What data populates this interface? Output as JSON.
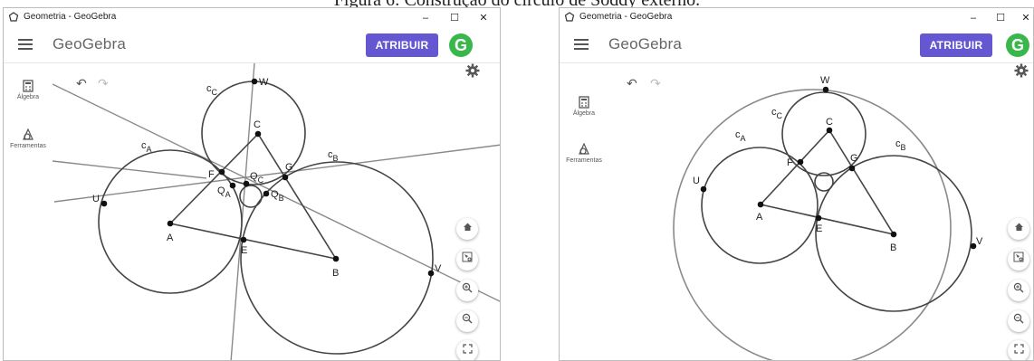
{
  "caption": "Figura 6: Construção do círculo de Soddy externo.",
  "windows": [
    {
      "title": "Geometria - GeoGebra",
      "controls": {
        "minimize": "–",
        "maximize": "☐",
        "close": "✕"
      },
      "brand": "GeoGebra",
      "assign_label": "ATRIBUIR",
      "avatar_letter": "G",
      "sidebar": {
        "algebra": "Álgebra",
        "tools": "Ferramentas"
      },
      "labels": {
        "W": "W",
        "C": "C",
        "cC": "c",
        "cC_sub": "C",
        "cA": "c",
        "cA_sub": "A",
        "cB": "c",
        "cB_sub": "B",
        "F": "F",
        "G": "G",
        "QC": "Q",
        "QC_sub": "C",
        "QA": "Q",
        "QA_sub": "A",
        "QB": "Q",
        "QB_sub": "B",
        "U": "U",
        "A": "A",
        "E": "E",
        "B": "B",
        "V": "V"
      }
    },
    {
      "title": "Geometria - GeoGebra",
      "controls": {
        "minimize": "–",
        "maximize": "☐",
        "close": "✕"
      },
      "brand": "GeoGebra",
      "assign_label": "ATRIBUIR",
      "avatar_letter": "G",
      "sidebar": {
        "algebra": "Álgebra",
        "tools": "Ferramentas"
      },
      "labels": {
        "W": "W",
        "C": "C",
        "cC": "c",
        "cC_sub": "C",
        "cA": "c",
        "cA_sub": "A",
        "cB": "c",
        "cB_sub": "B",
        "F": "F",
        "G": "G",
        "U": "U",
        "A": "A",
        "E": "E",
        "B": "B",
        "V": "V"
      }
    }
  ],
  "colors": {
    "accent": "#6557d2",
    "avatar": "#3ab74a",
    "stroke": "#444444",
    "line": "#8a8a8a"
  },
  "icons": [
    "app-icon",
    "menu-icon",
    "calculator-icon",
    "tools-icon",
    "undo-icon",
    "redo-icon",
    "gear-icon",
    "home-icon",
    "zoom-to-fit-icon",
    "zoom-in-icon",
    "zoom-out-icon",
    "fullscreen-icon"
  ]
}
